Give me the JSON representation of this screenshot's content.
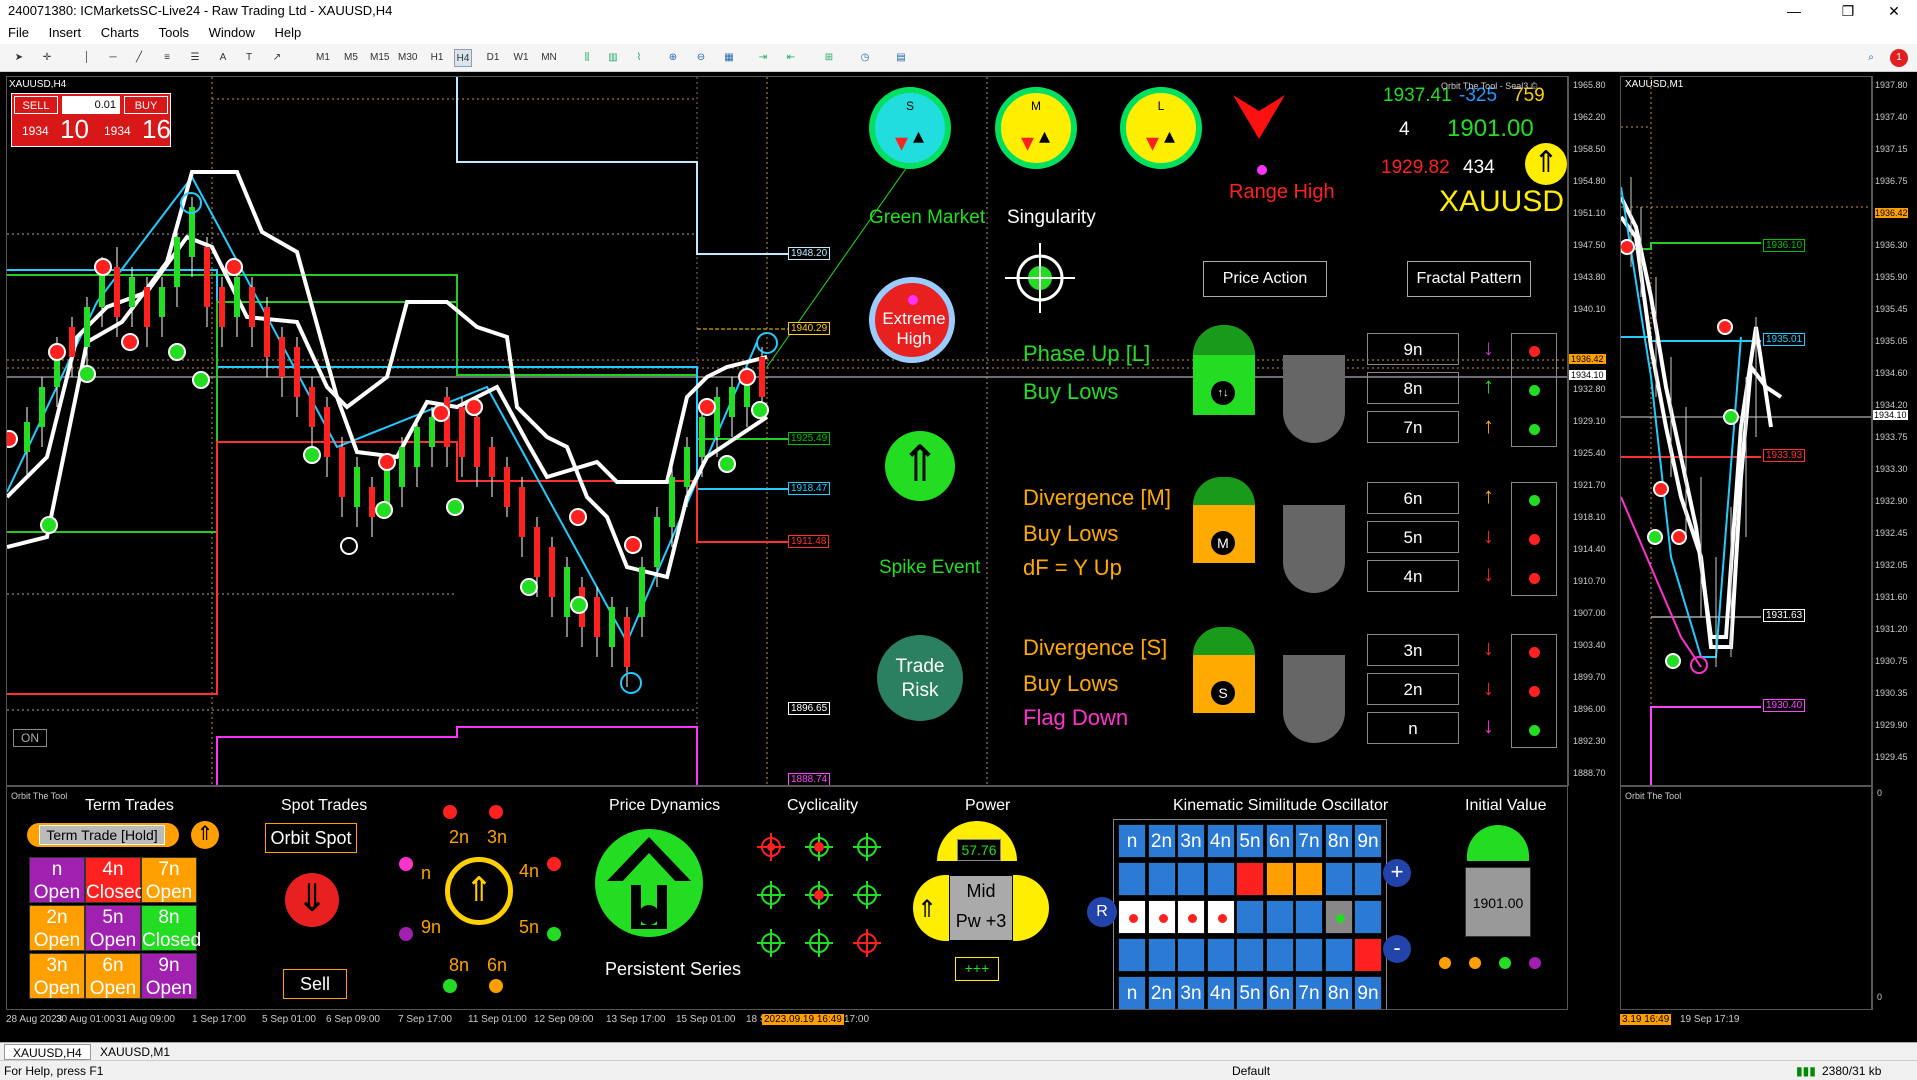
{
  "window": {
    "title": "240071380: ICMarketsSC-Live24 - Raw Trading Ltd - XAUUSD,H4",
    "minimize": "—",
    "maximize": "❐",
    "close": "✕"
  },
  "menu": [
    "File",
    "Insert",
    "Charts",
    "Tools",
    "Window",
    "Help"
  ],
  "toolbar": {
    "timeframes": [
      "M1",
      "M5",
      "M15",
      "M30",
      "H1",
      "H4",
      "D1",
      "W1",
      "MN"
    ],
    "active_timeframe": "H4",
    "badge": "1"
  },
  "main_chart": {
    "symbol": "XAUUSD,H4",
    "sell_label": "SELL",
    "buy_label": "BUY",
    "lot": "0.01",
    "sell_big": "1934",
    "sell_small": "10",
    "buy_big": "1934",
    "buy_small": "16",
    "on_button": "ON",
    "indicator_title": "Orbit The Tool - Seal3 ©",
    "price_axis": [
      "1965.80",
      "1962.20",
      "1958.50",
      "1954.80",
      "1951.10",
      "1947.50",
      "1943.80",
      "1940.10",
      "1936.42",
      "1934.10",
      "1932.80",
      "1929.10",
      "1925.40",
      "1921.70",
      "1918.10",
      "1914.40",
      "1910.70",
      "1907.00",
      "1903.40",
      "1899.70",
      "1896.00",
      "1892.30",
      "1888.70"
    ],
    "level_labels": [
      {
        "text": "1948.20",
        "color": "#bfe9ff"
      },
      {
        "text": "1940.29",
        "color": "#ffd000"
      },
      {
        "text": "1925.49",
        "color": "#00c000"
      },
      {
        "text": "1918.47",
        "color": "#22ccff"
      },
      {
        "text": "1911.48",
        "color": "#ff3030"
      },
      {
        "text": "1896.65",
        "color": "#ffffff"
      },
      {
        "text": "1888.74",
        "color": "#ff44ff"
      }
    ],
    "time_axis": [
      "28 Aug 2023",
      "30 Aug 01:00",
      "31 Aug 09:00",
      "1 Sep 17:00",
      "5 Sep 01:00",
      "6 Sep 09:00",
      "7 Sep 17:00",
      "11 Sep 01:00",
      "12 Sep 09:00",
      "13 Sep 17:00",
      "15 Sep 01:00",
      "18 S",
      "2023.09.19 16:49",
      "17:00"
    ]
  },
  "dashboard": {
    "gauges": [
      {
        "letter": "S",
        "ring": "#00e060",
        "fill": "#22dddd"
      },
      {
        "letter": "M",
        "ring": "#00e060",
        "fill": "#ffee00"
      },
      {
        "letter": "L",
        "ring": "#00e060",
        "fill": "#ffee00"
      }
    ],
    "range_high": "Range High",
    "prices": {
      "p1": "1937.41",
      "p2": "-325",
      "p3": "759",
      "count": "4",
      "p4": "1901.00",
      "p5": "1929.82",
      "p6": "434",
      "symbol": "XAUUSD"
    },
    "green_market": "Green Market",
    "singularity": "Singularity",
    "extreme_high": "Extreme High",
    "spike_event": "Spike Event",
    "trade_risk": "Trade Risk",
    "price_action": "Price Action",
    "fractal_pattern": "Fractal Pattern",
    "phase_up": "Phase Up [L]",
    "buy_lows_1": "Buy Lows",
    "divergence_m": "Divergence [M]",
    "buy_lows_2": "Buy Lows",
    "df": "dF = Y Up",
    "divergence_s": "Divergence [S]",
    "buy_lows_3": "Buy Lows",
    "flag_down": "Flag Down",
    "badge_m": "M",
    "badge_s": "S",
    "n_boxes": [
      "9n",
      "8n",
      "7n",
      "6n",
      "5n",
      "4n",
      "3n",
      "2n",
      "n"
    ],
    "arrows": [
      {
        "dir": "↓",
        "color": "#cc33cc"
      },
      {
        "dir": "↑",
        "color": "#22dd22"
      },
      {
        "dir": "↑",
        "color": "#ffaa00"
      },
      {
        "dir": "↑",
        "color": "#ffaa00"
      },
      {
        "dir": "↓",
        "color": "#ff2020"
      },
      {
        "dir": "↓",
        "color": "#ff2020"
      },
      {
        "dir": "↓",
        "color": "#ff2020"
      },
      {
        "dir": "↓",
        "color": "#ff2020"
      },
      {
        "dir": "↓",
        "color": "#ff33cc"
      }
    ],
    "dots": [
      "#ff2020",
      "#22dd22",
      "#22dd22",
      "#22dd22",
      "#ff2020",
      "#ff2020",
      "#ff2020",
      "#ff2020",
      "#22dd22"
    ]
  },
  "bottom_panel": {
    "title": "Orbit The Tool",
    "term_trades": "Term Trades",
    "term_trade_hold": "Term Trade [Hold]",
    "grid": [
      {
        "a": "n",
        "b": "Open",
        "bg": "#a020b0"
      },
      {
        "a": "4n",
        "b": "Closed",
        "bg": "#ff2020"
      },
      {
        "a": "7n",
        "b": "Open",
        "bg": "#ffa000"
      },
      {
        "a": "2n",
        "b": "Open",
        "bg": "#ffa000"
      },
      {
        "a": "5n",
        "b": "Open",
        "bg": "#a020b0"
      },
      {
        "a": "8n",
        "b": "Closed",
        "bg": "#22dd22"
      },
      {
        "a": "3n",
        "b": "Open",
        "bg": "#ffa000"
      },
      {
        "a": "6n",
        "b": "Open",
        "bg": "#ffa000"
      },
      {
        "a": "9n",
        "b": "Open",
        "bg": "#a020b0"
      }
    ],
    "spot_trades": "Spot Trades",
    "orbit_spot": "Orbit Spot",
    "sell": "Sell",
    "wheel": [
      "2n",
      "3n",
      "n",
      "4n",
      "9n",
      "5n",
      "8n",
      "6n"
    ],
    "price_dynamics": "Price Dynamics",
    "persistent_series": "Persistent Series",
    "cyclicality": "Cyclicality",
    "power": "Power",
    "power_value": "57.76",
    "mid": "Mid",
    "pw": "Pw +3",
    "plus_bar": "+++",
    "kso_title": "Kinematic Similitude Oscillator",
    "kso_header": [
      "n",
      "2n",
      "3n",
      "4n",
      "5n",
      "6n",
      "7n",
      "8n",
      "9n"
    ],
    "kso_r": "R",
    "kso_plus": "+",
    "kso_minus": "-",
    "initial_value": "Initial Value",
    "initial_number": "1901.00"
  },
  "side_chart": {
    "symbol": "XAUUSD,M1",
    "indicator_title": "Orbit The Tool",
    "price_axis": [
      "1937.80",
      "1937.40",
      "1937.15",
      "1936.75",
      "1936.42",
      "1936.30",
      "1935.90",
      "1935.45",
      "1935.05",
      "1934.60",
      "1934.20",
      "1933.75",
      "1933.30",
      "1932.90",
      "1932.45",
      "1932.05",
      "1931.60",
      "1931.20",
      "1930.75",
      "1930.35",
      "1929.90",
      "1929.45"
    ],
    "level_labels": [
      {
        "text": "1936.10",
        "color": "#00c000"
      },
      {
        "text": "1935.01",
        "color": "#22ccff"
      },
      {
        "text": "1933.93",
        "color": "#ff3030"
      },
      {
        "text": "1931.63",
        "color": "#ffffff"
      },
      {
        "text": "1930.40",
        "color": "#ff44ff"
      },
      {
        "text": "1934.10",
        "color": "#ffffff"
      }
    ],
    "time_axis": [
      "3.19 16:49",
      "19 Sep 17:19"
    ],
    "subaxis_top": "0",
    "subaxis_bottom": "0"
  },
  "tabs": [
    "XAUUSD,H4",
    "XAUUSD,M1"
  ],
  "status": {
    "help": "For Help, press F1",
    "profile": "Default",
    "traffic": "2380/31 kb"
  }
}
